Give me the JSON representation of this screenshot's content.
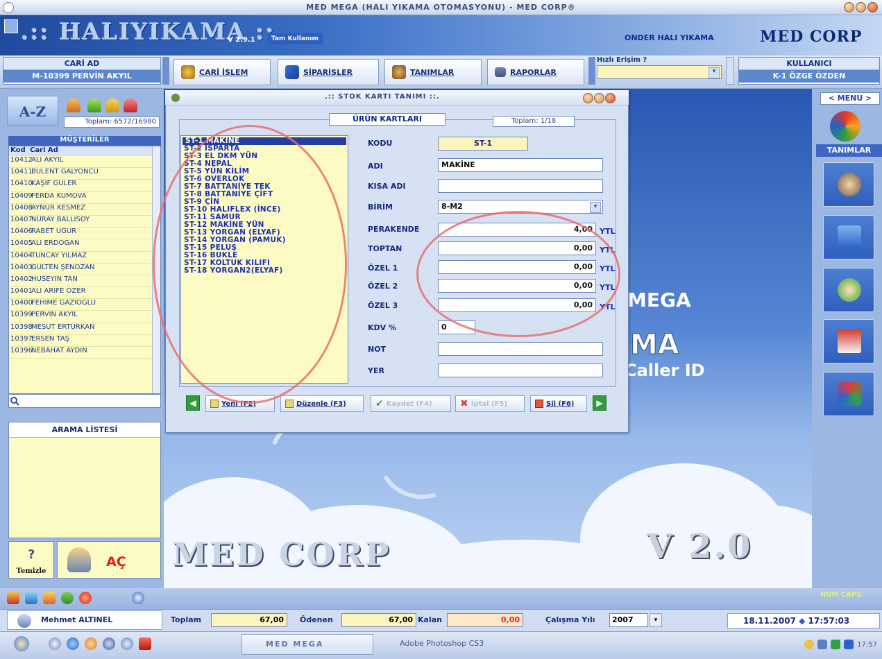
{
  "window": {
    "title": "MED MEGA    (HALI YIKAMA OTOMASYONU)  -  MED CORP®"
  },
  "header": {
    "logo": ".:: HALIYIKAMA ::.",
    "version": "V 2.9.1",
    "edition": "Tam Kullanım",
    "firm": "ONDER HALI YIKAMA",
    "brand": "MED CORP"
  },
  "toolbar": {
    "cari_label": "CARİ AD",
    "cari_value": "M-10399 PERVİN AKYIL",
    "buttons": [
      "CARİ İŞLEM",
      "SİPARİŞLER",
      "TANIMLAR",
      "RAPORLAR"
    ],
    "quick_label": "Hızlı Erişim ?",
    "user_label": "KULLANICI",
    "user_value": "K-1 ÖZGE ÖZDEN"
  },
  "left": {
    "toplam": "Toplam: 6572/16980",
    "customers_title": "MÜŞTERİLER",
    "columns": [
      "Kod",
      "Cari Ad"
    ],
    "customers": [
      [
        "10412",
        "ALİ AKYIL"
      ],
      [
        "10411",
        "BÜLENT GALYONCU"
      ],
      [
        "10410",
        "KAŞİF GÜLER"
      ],
      [
        "10409",
        "FERDA KUMOVA"
      ],
      [
        "10408",
        "AYNUR KESMEZ"
      ],
      [
        "10407",
        "NURAY BALLISOY"
      ],
      [
        "10406",
        "RABET UĞUR"
      ],
      [
        "10405",
        "ALİ ERDOĞAN"
      ],
      [
        "10404",
        "TUNCAY YILMAZ"
      ],
      [
        "10403",
        "GÜLTEN ŞENOZAN"
      ],
      [
        "10402",
        "HÜSEYİN TAN"
      ],
      [
        "10401",
        "ALİ ARİFE ÖZER"
      ],
      [
        "10400",
        "FEHİME GAZİOĞLU"
      ],
      [
        "10399",
        "PERVİN AKYIL"
      ],
      [
        "10398",
        "MESUT ERTÜRKAN"
      ],
      [
        "10397",
        "ERSEN TAŞ"
      ],
      [
        "10396",
        "NEBAHAT AYDIN"
      ]
    ],
    "arama_title": "ARAMA LİSTESİ",
    "temizle": "Temizle",
    "ac": "AÇ"
  },
  "dialog": {
    "title": ".:: STOK KARTI TANIMI ::.",
    "section": "ÜRÜN KARTLARI",
    "toplam": "Toplam: 1/18",
    "products": [
      "ST-1 MAKİNE",
      "ST-2 ISPARTA",
      "ST-3 EL DKM YÜN",
      "ST-4 NEPAL",
      "ST-5 YÜN KİLİM",
      "ST-6 OVERLOK",
      "ST-7 BATTANİYE TEK",
      "ST-8 BATTANİYE ÇİFT",
      "ST-9 ÇİN",
      "ST-10 HALIFLEX (İNCE)",
      "ST-11 SAMUR",
      "ST-12 MAKİNE YÜN",
      "ST-13 YORGAN (ELYAF)",
      "ST-14 YORGAN (PAMUK)",
      "ST-15 PELUŞ",
      "ST-16 BUKLE",
      "ST-17 KOLTUK KILIFI",
      "ST-18 YORGAN2(ELYAF)"
    ],
    "selected_index": 0,
    "fields": {
      "kodu_label": "KODU",
      "kodu": "ST-1",
      "adi_label": "ADI",
      "adi": "MAKİNE",
      "kisa_label": "KISA ADI",
      "kisa": "",
      "birim_label": "BİRİM",
      "birim": "8-M2",
      "perakende_label": "PERAKENDE",
      "perakende": "4,00",
      "toptan_label": "TOPTAN",
      "toptan": "0,00",
      "ozel1_label": "ÖZEL 1",
      "ozel1": "0,00",
      "ozel2_label": "ÖZEL 2",
      "ozel2": "0,00",
      "ozel3_label": "ÖZEL 3",
      "ozel3": "0,00",
      "kdv_label": "KDV %",
      "kdv": "0",
      "not_label": "NOT",
      "not": "",
      "yer_label": "YER",
      "yer": "",
      "currency": "YTL"
    },
    "buttons": {
      "yeni": "Yeni (F2)",
      "duzenle": "Düzenle (F3)",
      "kaydet": "Kaydet (F4)",
      "iptal": "İptal (F5)",
      "sil": "Sil (F6)"
    }
  },
  "background": {
    "mega": "MEGA",
    "caller": "Caller ID",
    "medcorp": "MED CORP",
    "version": "V 2.0"
  },
  "right": {
    "menu": "< MENU >",
    "tanimlar": "TANIMLAR",
    "numcaps": "NUM  CAPS"
  },
  "status": {
    "user": "Mehmet ALTINEL",
    "toplam_label": "Toplam",
    "toplam": "67,00",
    "odenen_label": "Ödenen",
    "odenen": "67,00",
    "kalan_label": "Kalan",
    "kalan": "0,00",
    "yil_label": "Çalışma Yılı",
    "yil": "2007",
    "date": "18.11.2007",
    "time": "17:57:03"
  },
  "taskbar": {
    "app1": "MED MEGA",
    "app2": "Adobe Photoshop CS3",
    "clock": "17:57"
  },
  "colors": {
    "accent": "#2f5ebd",
    "list_bg": "#fdfbc4",
    "highlight": "#e86e6e"
  }
}
